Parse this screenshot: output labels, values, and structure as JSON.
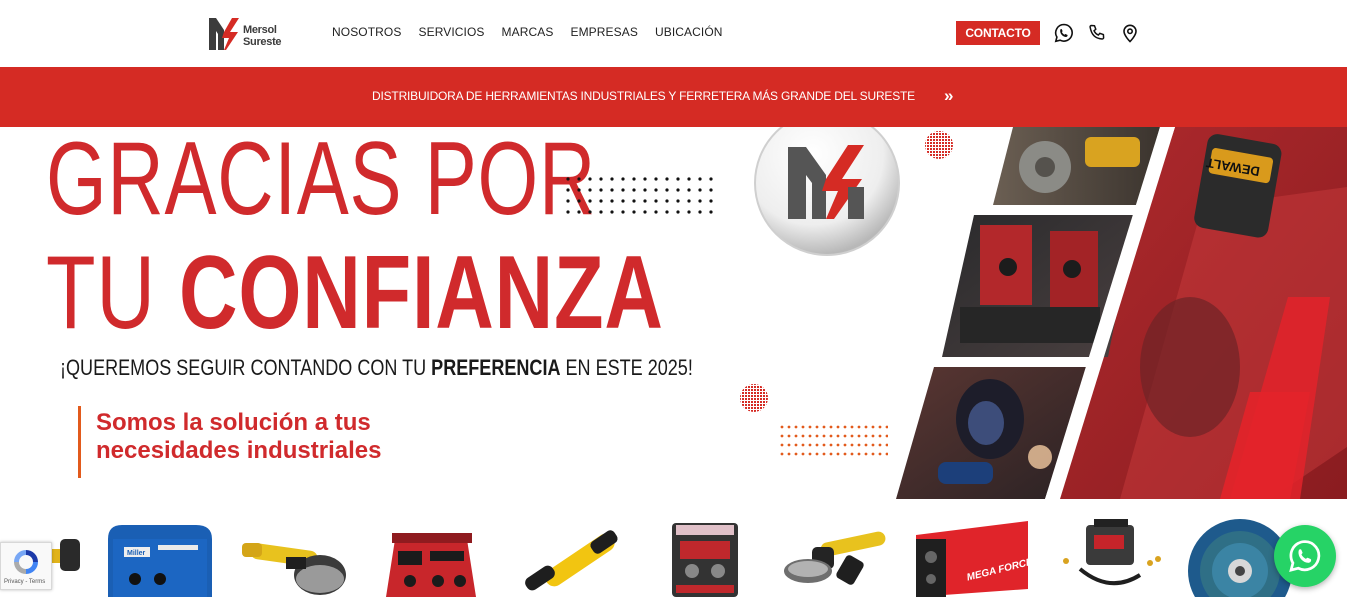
{
  "brand": {
    "logo_line1": "Mersol",
    "logo_line2": "Sureste",
    "colors": {
      "primary_red": "#d52b24",
      "dark_gray": "#3c3c3c",
      "whatsapp_green": "#26d366"
    }
  },
  "nav": {
    "items": [
      {
        "label": "NOSOTROS"
      },
      {
        "label": "SERVICIOS"
      },
      {
        "label": "MARCAS"
      },
      {
        "label": "EMPRESAS"
      },
      {
        "label": "UBICACIÓN"
      }
    ],
    "contact_label": "CONTACTO",
    "icons": [
      "whatsapp-icon",
      "phone-icon",
      "location-pin-icon"
    ]
  },
  "promo": {
    "text": "DISTRIBUIDORA DE HERRAMIENTAS INDUSTRIALES Y FERRETERA MÁS GRANDE DEL SURESTE",
    "arrow": "»"
  },
  "hero": {
    "title_line1": "GRACIAS POR",
    "title_line2_a": "TU ",
    "title_line2_b": "CONFIANZA",
    "subtitle_a": "¡QUEREMOS SEGUIR CONTANDO CON TU ",
    "subtitle_b": "PREFERENCIA",
    "subtitle_c": " EN ESTE 2025!",
    "slogan": "Somos la solución a tus necesidades industriales",
    "photo_brand_text": "DEWALT"
  },
  "carousel": {
    "products": [
      {
        "name": "grinder-partial"
      },
      {
        "name": "miller-welder",
        "label": "Miller"
      },
      {
        "name": "dewalt-angle-grinder-large"
      },
      {
        "name": "lincoln-welder"
      },
      {
        "name": "dewalt-die-grinder"
      },
      {
        "name": "lincoln-welder-compact"
      },
      {
        "name": "dewalt-angle-grinder"
      },
      {
        "name": "mega-force-welder",
        "label": "MEGA FORCE"
      },
      {
        "name": "plasma-cutter"
      },
      {
        "name": "flap-disc"
      }
    ]
  },
  "recaptcha": {
    "terms": "Privacy - Terms"
  }
}
